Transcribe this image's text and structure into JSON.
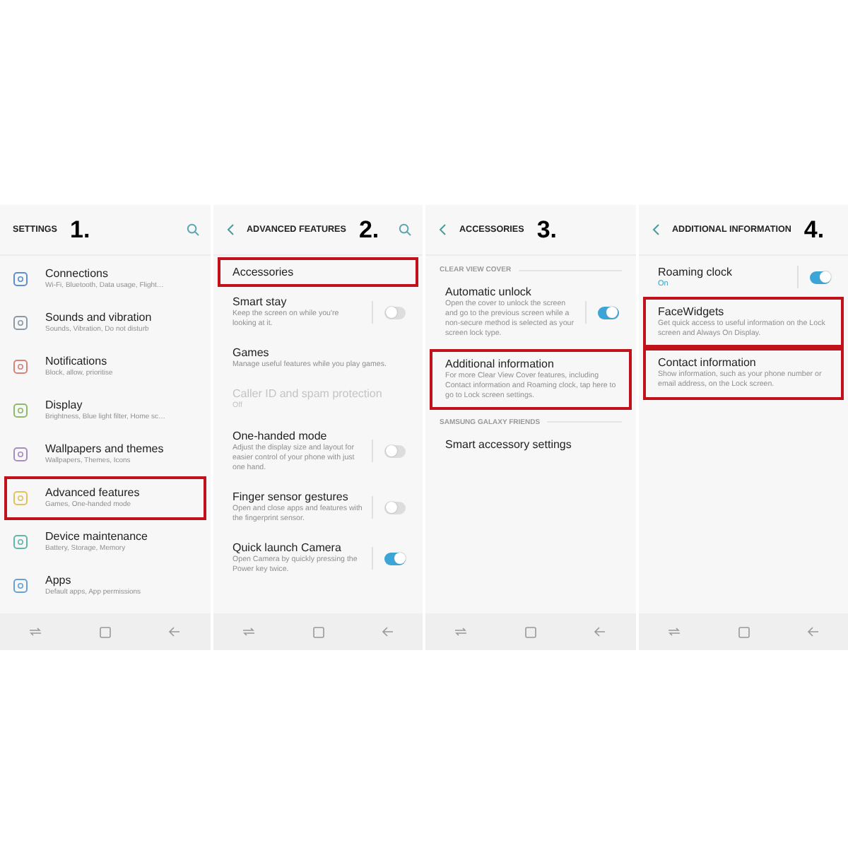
{
  "panels": [
    {
      "step": "1.",
      "title": "SETTINGS",
      "back": false,
      "search": true,
      "items": [
        {
          "kind": "icon-item",
          "title": "Connections",
          "subtitle": "Wi-Fi, Bluetooth, Data usage, Flight…",
          "color": "#5b8fd6",
          "highlighted": false
        },
        {
          "kind": "icon-item",
          "title": "Sounds and vibration",
          "subtitle": "Sounds, Vibration, Do not disturb",
          "color": "#8a9aa8",
          "highlighted": false
        },
        {
          "kind": "icon-item",
          "title": "Notifications",
          "subtitle": "Block, allow, prioritise",
          "color": "#d9827a",
          "highlighted": false
        },
        {
          "kind": "icon-item",
          "title": "Display",
          "subtitle": "Brightness, Blue light filter, Home sc…",
          "color": "#8fba6a",
          "highlighted": false
        },
        {
          "kind": "icon-item",
          "title": "Wallpapers and themes",
          "subtitle": "Wallpapers, Themes, Icons",
          "color": "#a98cc4",
          "highlighted": false
        },
        {
          "kind": "icon-item",
          "title": "Advanced features",
          "subtitle": "Games, One-handed mode",
          "color": "#e0c45a",
          "highlighted": true
        },
        {
          "kind": "icon-item",
          "title": "Device maintenance",
          "subtitle": "Battery, Storage, Memory",
          "color": "#5fb8a8",
          "highlighted": false
        },
        {
          "kind": "icon-item",
          "title": "Apps",
          "subtitle": "Default apps, App permissions",
          "color": "#6aa0d8",
          "highlighted": false
        }
      ]
    },
    {
      "step": "2.",
      "title": "ADVANCED FEATURES",
      "back": true,
      "search": true,
      "items": [
        {
          "kind": "item",
          "title": "Accessories",
          "highlighted": true,
          "disabled": false
        },
        {
          "kind": "toggle",
          "title": "Smart stay",
          "subtitle": "Keep the screen on while you're looking at it.",
          "on": false,
          "highlighted": false
        },
        {
          "kind": "item",
          "title": "Games",
          "subtitle": "Manage useful features while you play games.",
          "highlighted": false,
          "disabled": false
        },
        {
          "kind": "item",
          "title": "Caller ID and spam protection",
          "subtitle": "Off",
          "highlighted": false,
          "disabled": true
        },
        {
          "kind": "toggle",
          "title": "One-handed mode",
          "subtitle": "Adjust the display size and layout for easier control of your phone with just one hand.",
          "on": false,
          "highlighted": false
        },
        {
          "kind": "toggle",
          "title": "Finger sensor gestures",
          "subtitle": "Open and close apps and features with the fingerprint sensor.",
          "on": false,
          "highlighted": false
        },
        {
          "kind": "toggle",
          "title": "Quick launch Camera",
          "subtitle": "Open Camera by quickly pressing the Power key twice.",
          "on": true,
          "highlighted": false
        }
      ]
    },
    {
      "step": "3.",
      "title": "ACCESSORIES",
      "back": true,
      "search": false,
      "items": [
        {
          "kind": "header",
          "title": "CLEAR VIEW COVER"
        },
        {
          "kind": "toggle",
          "title": "Automatic unlock",
          "subtitle": "Open the cover to unlock the screen and go to the previous screen while a non-secure method is selected as your screen lock type.",
          "on": true,
          "highlighted": false
        },
        {
          "kind": "item",
          "title": "Additional information",
          "subtitle": "For more Clear View Cover features, including Contact information and Roaming clock, tap here to go to Lock screen settings.",
          "highlighted": true,
          "disabled": false
        },
        {
          "kind": "header",
          "title": "SAMSUNG GALAXY FRIENDS"
        },
        {
          "kind": "item",
          "title": "Smart accessory settings",
          "highlighted": false,
          "disabled": false
        }
      ]
    },
    {
      "step": "4.",
      "title": "ADDITIONAL INFORMATION",
      "back": true,
      "search": false,
      "items": [
        {
          "kind": "toggle",
          "title": "Roaming clock",
          "status": "On",
          "on": true,
          "highlighted": false
        },
        {
          "kind": "item",
          "title": "FaceWidgets",
          "subtitle": "Get quick access to useful information on the Lock screen and Always On Display.",
          "highlighted": true,
          "disabled": false
        },
        {
          "kind": "item",
          "title": "Contact information",
          "subtitle": "Show information, such as your phone number or email address, on the Lock screen.",
          "highlighted": true,
          "disabled": false
        }
      ]
    }
  ]
}
